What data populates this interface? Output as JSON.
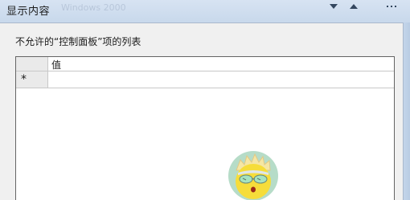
{
  "window": {
    "title": "显示内容",
    "ghost_title": "Windows 2000"
  },
  "dialog": {
    "list_label": "不允许的“控制面板”项的列表"
  },
  "grid": {
    "column_header": "值",
    "new_row_marker": "*",
    "rows": [
      {
        "value": ""
      }
    ]
  },
  "colors": {
    "titlebar": "#c9d9ec",
    "client_background": "#f0f0f0",
    "grid_border": "#646464"
  }
}
